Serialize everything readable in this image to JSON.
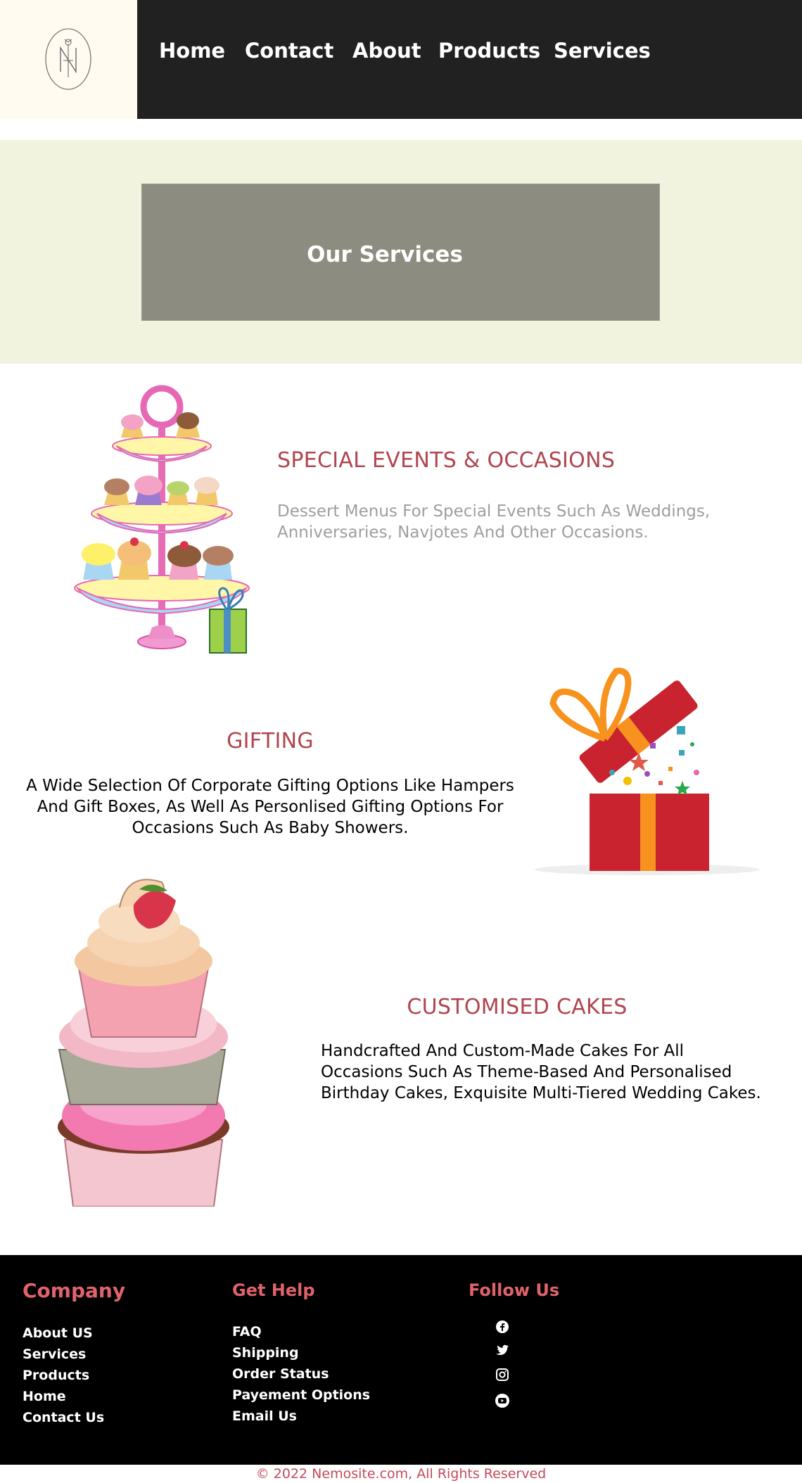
{
  "nav": {
    "items": [
      "Home",
      "Contact",
      "About",
      "Products",
      "Services"
    ]
  },
  "banner": {
    "title": "Our Services"
  },
  "services": [
    {
      "title": "SPECIAL EVENTS & OCCASIONS",
      "text_lines": [
        "Dessert Menus For Special Events Such As Weddings,",
        "Anniversaries, Navjotes And Other Occasions."
      ]
    },
    {
      "title": "GIFTING",
      "text_lines": [
        "A Wide Selection Of Corporate Gifting Options Like Hampers",
        "And Gift Boxes, As Well As Personlised Gifting Options For",
        "Occasions Such As Baby Showers."
      ]
    },
    {
      "title": "CUSTOMISED CAKES",
      "text_lines": [
        "Handcrafted And Custom-Made Cakes For All",
        "Occasions Such As Theme-Based And Personalised",
        "Birthday Cakes, Exquisite Multi-Tiered Wedding Cakes."
      ]
    }
  ],
  "footer": {
    "company": {
      "heading": "Company",
      "links": [
        "About US",
        "Services",
        "Products",
        "Home",
        "Contact Us"
      ]
    },
    "help": {
      "heading": "Get Help",
      "links": [
        "FAQ",
        "Shipping",
        "Order Status",
        "Payement Options",
        "Email Us"
      ]
    },
    "follow": {
      "heading": "Follow Us",
      "icons": [
        "facebook-icon",
        "twitter-icon",
        "instagram-icon",
        "youtube-icon"
      ]
    },
    "copyright": "© 2022 Nemosite.com, All Rights Reserved"
  },
  "colors": {
    "nav_bg": "#212121",
    "logo_bg": "#fffbf1",
    "banner_bg": "#f2f3df",
    "banner_box": "#8c8c80",
    "title_red": "#b0454f",
    "footer_heading": "#e0636b",
    "footer_bg": "#000000"
  }
}
